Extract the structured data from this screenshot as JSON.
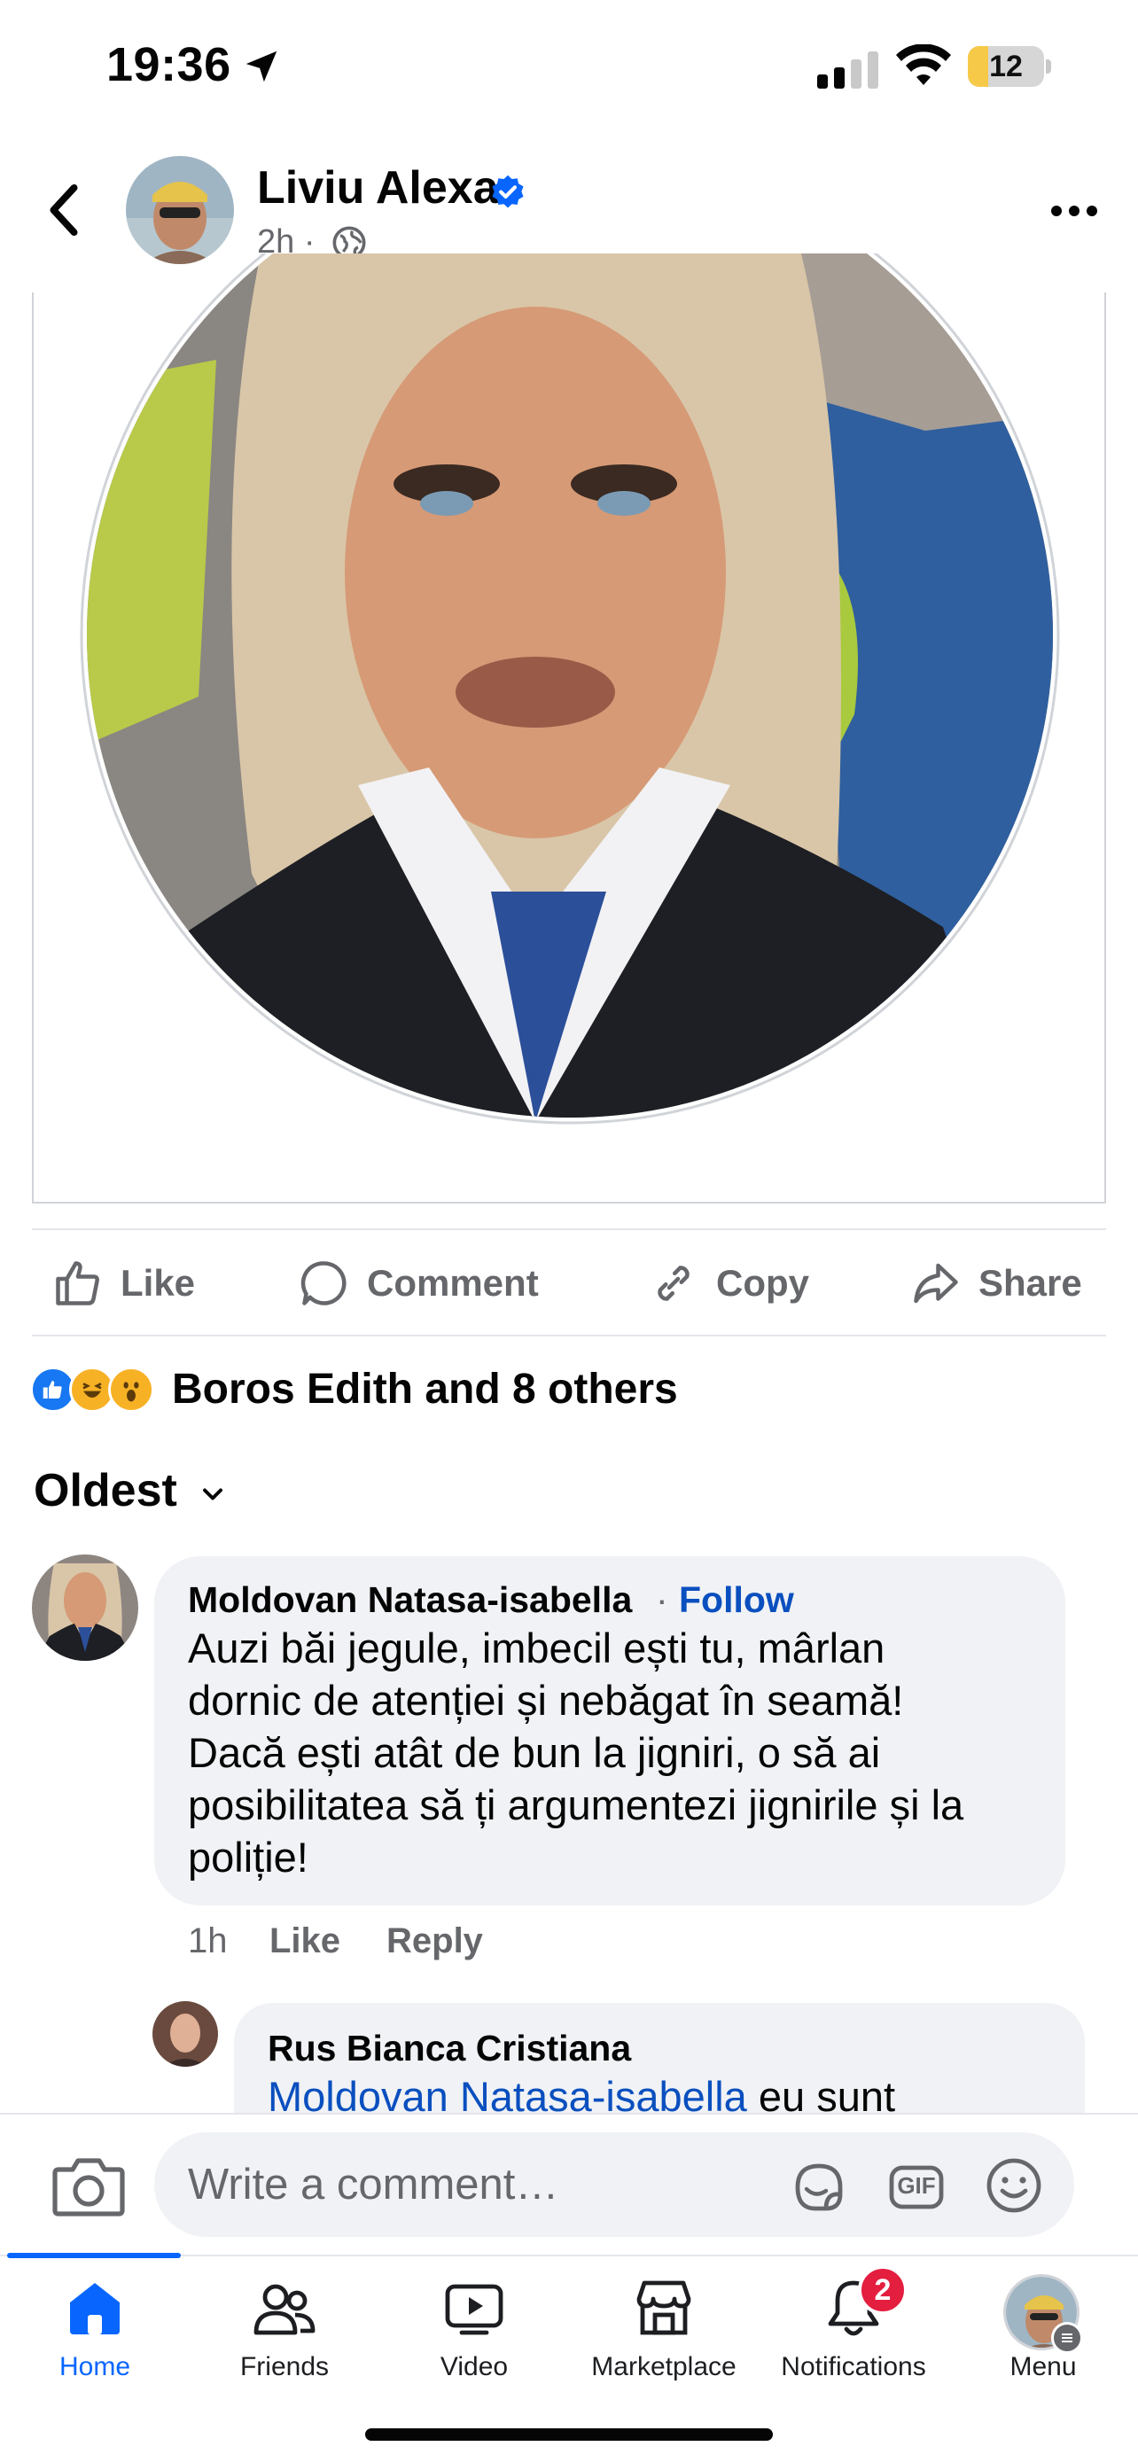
{
  "status_bar": {
    "time": "19:36",
    "battery": "12",
    "battery_level": 0.12,
    "icons": [
      "location-arrow-icon",
      "signal-icon",
      "wifi-icon",
      "battery-icon"
    ]
  },
  "post": {
    "author": "Liviu Alexa",
    "verified": true,
    "time_ago": "2h",
    "separator": "·",
    "audience_icon": "globe-icon"
  },
  "actions": {
    "like": "Like",
    "comment": "Comment",
    "copy": "Copy",
    "share": "Share"
  },
  "reactions": {
    "types": [
      "like",
      "haha",
      "wow"
    ],
    "text": "Boros Edith and 8 others"
  },
  "sort": {
    "label": "Oldest"
  },
  "comments": [
    {
      "name": "Moldovan Natasa-isabella",
      "dot": "·",
      "follow": "Follow",
      "lines": [
        "Auzi băi jegule, imbecil ești tu, mârlan",
        "dornic de atenției și nebăgat în seamă!",
        "Dacă ești atât de bun la jigniri, o să ai",
        "posibilitatea să ți argumentezi jignirile și la",
        "poliție!"
      ],
      "time": "1h",
      "like": "Like",
      "reply": "Reply"
    }
  ],
  "reply": {
    "name": "Rus Bianca Cristiana",
    "mention": "Moldovan Natasa-isabella",
    "text": " eu sunt"
  },
  "composer": {
    "placeholder": "Write a comment…",
    "gif": "GIF"
  },
  "tabbar": {
    "items": [
      {
        "label": "Home",
        "icon": "home-icon",
        "active": true
      },
      {
        "label": "Friends",
        "icon": "friends-icon"
      },
      {
        "label": "Video",
        "icon": "video-icon"
      },
      {
        "label": "Marketplace",
        "icon": "marketplace-icon"
      },
      {
        "label": "Notifications",
        "icon": "bell-icon",
        "badge": "2"
      },
      {
        "label": "Menu",
        "icon": "profile-avatar"
      }
    ]
  },
  "colors": {
    "accent": "#0866ff",
    "link": "#0a4fbf",
    "secondary_text": "#65676b",
    "bubble": "#f0f2f5",
    "badge": "#e41e3f"
  }
}
